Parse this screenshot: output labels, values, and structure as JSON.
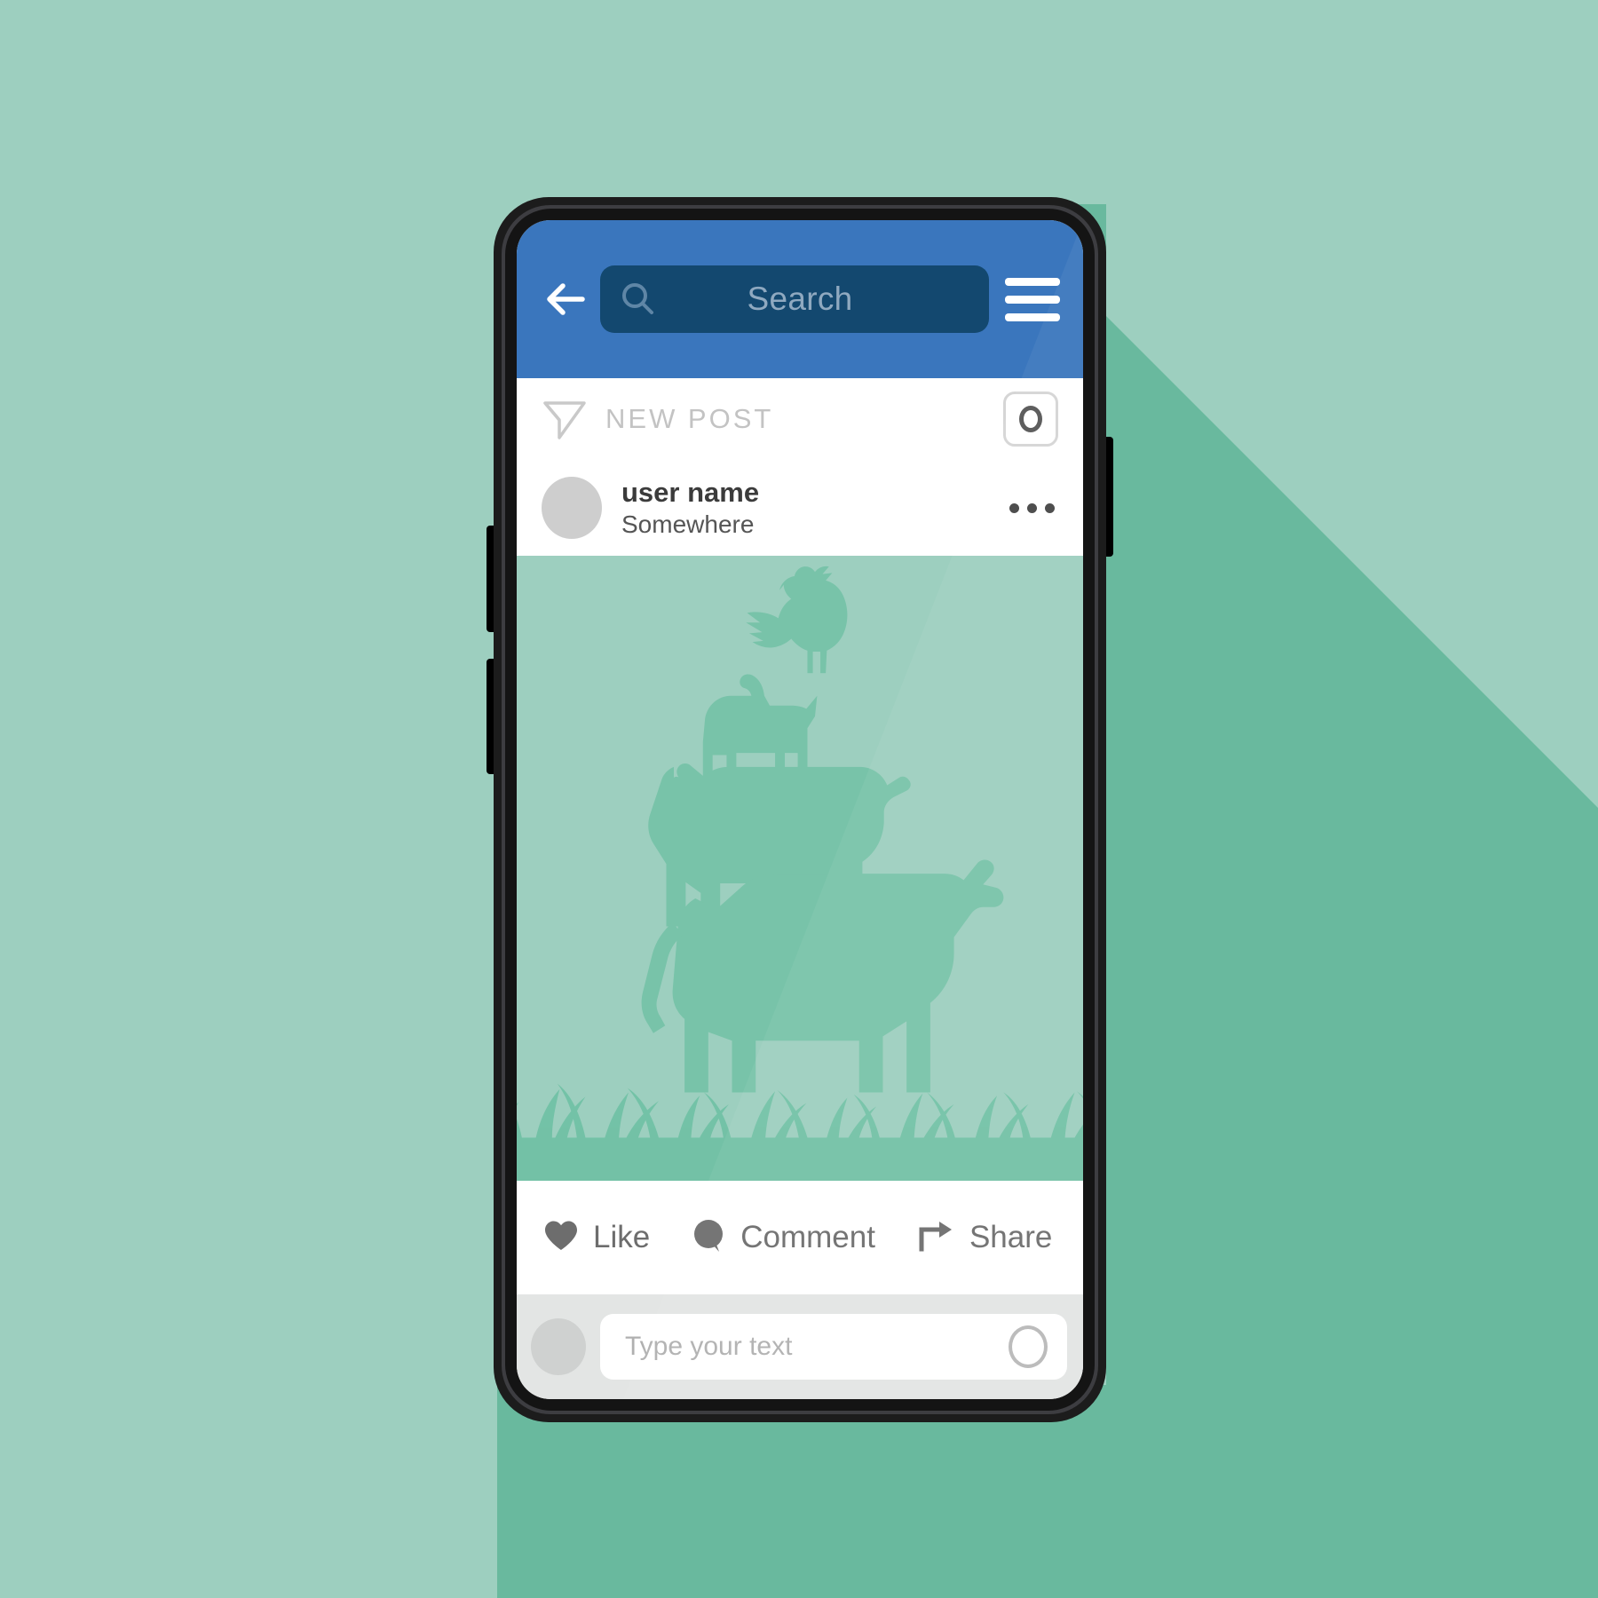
{
  "colors": {
    "page_background": "#9dcfbf",
    "long_shadow": "#69b99e",
    "appbar_blue": "#3a76bd",
    "search_field_blue": "#13486f",
    "search_placeholder": "#8fa9c0",
    "phone_frame": "#1c1c1c",
    "post_image_background": "#9dcfbf",
    "silhouette": "#6cbfa2",
    "comment_bar_background": "#e3e5e4",
    "avatar_gray": "#cecece",
    "action_text": "#6d6d6d",
    "new_post_label": "#c3c3c3"
  },
  "appbar": {
    "back_icon": "arrow-left-icon",
    "search": {
      "icon": "search-icon",
      "placeholder": "Search",
      "value": ""
    },
    "menu_icon": "hamburger-menu-icon"
  },
  "new_post": {
    "icon": "send-paper-plane-icon",
    "label": "NEW POST",
    "camera_button_icon": "camera-icon"
  },
  "post": {
    "avatar": "user-avatar",
    "username": "user name",
    "location": "Somewhere",
    "overflow_icon": "more-options-icon",
    "image_alt": "bremen-town-musicians-silhouette"
  },
  "actions": [
    {
      "icon": "heart-icon",
      "label": "Like"
    },
    {
      "icon": "comment-bubble-icon",
      "label": "Comment"
    },
    {
      "icon": "share-arrow-icon",
      "label": "Share"
    }
  ],
  "comment_bar": {
    "avatar": "current-user-avatar",
    "placeholder": "Type your text",
    "value": "",
    "send_icon": "send-circle-icon"
  }
}
